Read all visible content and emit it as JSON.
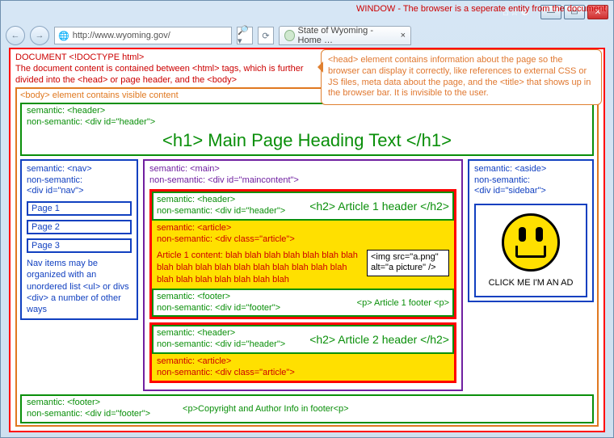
{
  "window": {
    "label": "WINDOW - The browser  is a seperate entity from the document",
    "url": "http://www.wyoming.gov/",
    "tab_title": "State of Wyoming - Home …"
  },
  "document": {
    "title": "DOCUMENT  <!DOCTYPE html>",
    "desc": "The document content is contained between <html> tags, which is further divided into the <head> or page header, and the <body>"
  },
  "head_explain": "<head> element contains information about the page so the browser can display it correctly, like references to external CSS or JS files, meta data about the page, and the <title> that shows up in the browser bar. It is invisible to the user.",
  "body_label": "<body> element contains visible content",
  "header": {
    "sem": "semantic: <header>",
    "non": "non-semantic: <div id=\"header\">",
    "h1": "<h1> Main Page Heading Text </h1>"
  },
  "nav": {
    "sem": "semantic: <nav>",
    "non": "non-semantic:",
    "non2": "<div id=\"nav\">",
    "items": [
      "Page 1",
      "Page 2",
      "Page  3"
    ],
    "note": "Nav items may be organized with an unordered list <ul> or divs <div> a number of other ways"
  },
  "main": {
    "sem": "semantic: <main>",
    "non": "non-semantic: <div id=\"maincontent\">"
  },
  "article1": {
    "sem": "semantic: <article>",
    "non": "non-semantic: <div class=\"article\">",
    "hdr_sem": "semantic: <header>",
    "hdr_non": "non-semantic: <div id=\"header\">",
    "h2": "<h2> Article 1 header </h2>",
    "content": "Article 1 content: blah blah blah blah blah blah blah blah blah blah blah blah blah blah blah blah blah blah blah blah blah blah blah blah",
    "img": "<img src=\"a.png\" alt=\"a picture\" />",
    "ftr_sem": "semantic: <footer>",
    "ftr_non": "non-semantic: <div id=\"footer\">",
    "ftr_p": "<p> Article 1 footer <p>"
  },
  "article2": {
    "hdr_sem": "semantic: <header>",
    "hdr_non": "non-semantic: <div id=\"header\">",
    "h2": "<h2> Article 2 header </h2>",
    "sem": "semantic: <article>",
    "non": "non-semantic: <div class=\"article\">"
  },
  "aside": {
    "sem": "semantic: <aside>",
    "non": "non-semantic:",
    "non2": "<div id=\"sidebar\">",
    "ad": "CLICK ME I'M AN AD"
  },
  "footer": {
    "sem": "semantic: <footer>",
    "non": "non-semantic: <div id=\"footer\">",
    "p": "<p>Copyright and Author Info in footer<p>"
  }
}
